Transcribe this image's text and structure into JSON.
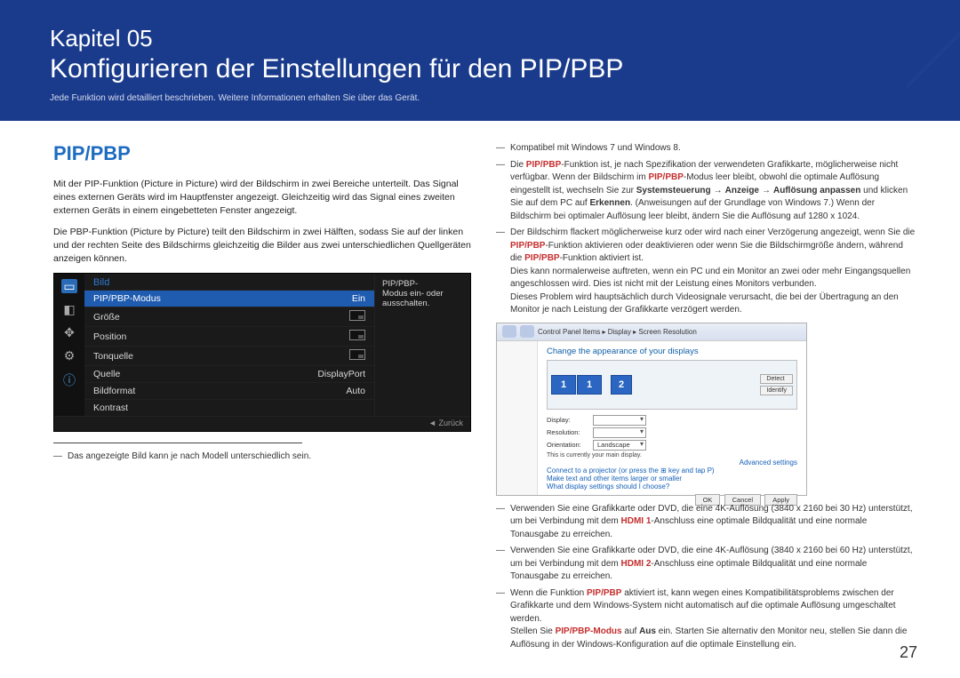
{
  "header": {
    "chapter_label": "Kapitel 05",
    "title": "Konfigurieren der Einstellungen für den PIP/PBP",
    "subtitle": "Jede Funktion wird detailliert beschrieben. Weitere Informationen erhalten Sie über das Gerät."
  },
  "left": {
    "section_title": "PIP/PBP",
    "para1": "Mit der PIP-Funktion (Picture in Picture) wird der Bildschirm in zwei Bereiche unterteilt. Das Signal eines externen Geräts wird im Hauptfenster angezeigt. Gleichzeitig wird das Signal eines zweiten externen Geräts in einem eingebetteten Fenster angezeigt.",
    "para2": "Die PBP-Funktion (Picture by Picture) teilt den Bildschirm in zwei Hälften, sodass Sie auf der linken und der rechten Seite des Bildschirms gleichzeitig die Bilder aus zwei unterschiedlichen Quellgeräten anzeigen können.",
    "footnote": "Das angezeigte Bild kann je nach Modell unterschiedlich sein."
  },
  "osd": {
    "head": "Bild",
    "desc_l1": "PIP/PBP-",
    "desc_l2": "Modus ein- oder",
    "desc_l3": "ausschalten.",
    "foot_symbol": "◄",
    "foot_label": "Zurück",
    "rows": [
      {
        "label": "PIP/PBP-Modus",
        "value": "Ein",
        "selected": true
      },
      {
        "label": "Größe",
        "value": "",
        "thumb": true
      },
      {
        "label": "Position",
        "value": "",
        "thumb": true
      },
      {
        "label": "Tonquelle",
        "value": "",
        "thumb": true
      },
      {
        "label": "Quelle",
        "value": "DisplayPort"
      },
      {
        "label": "Bildformat",
        "value": "Auto"
      },
      {
        "label": "Kontrast",
        "value": ""
      }
    ]
  },
  "right": {
    "note1": "Kompatibel mit Windows 7 und Windows 8.",
    "note2_a": "Die ",
    "note2_b": "PIP/PBP",
    "note2_c": "-Funktion ist, je nach Spezifikation der verwendeten Grafikkarte, möglicherweise nicht verfügbar. Wenn der Bildschirm im ",
    "note2_d": "PIP/PBP",
    "note2_e": "-Modus leer bleibt, obwohl die optimale Auflösung eingestellt ist, wechseln Sie zur ",
    "note2_f": "Systemsteuerung",
    "note2_g": "Anzeige",
    "note2_h": "Auflösung anpassen",
    "note2_i": " und klicken Sie auf dem PC auf ",
    "note2_j": "Erkennen",
    "note2_k": ". (Anweisungen auf der Grundlage von Windows 7.) Wenn der Bildschirm bei optimaler Auflösung leer bleibt, ändern Sie die Auflösung auf 1280 x 1024.",
    "note3_a": "Der Bildschirm flackert möglicherweise kurz oder wird nach einer Verzögerung angezeigt, wenn Sie die ",
    "note3_b": "PIP/PBP",
    "note3_c": "-Funktion aktivieren oder deaktivieren oder wenn Sie die Bildschirmgröße ändern, während die ",
    "note3_d": "PIP/PBP",
    "note3_e": "-Funktion aktiviert ist.",
    "note3_f": "Dies kann normalerweise auftreten, wenn ein PC und ein Monitor an zwei oder mehr Eingangsquellen angeschlossen wird. Dies ist nicht mit der Leistung eines Monitors verbunden.",
    "note3_g": "Dieses Problem wird hauptsächlich durch Videosignale verursacht, die bei der Übertragung an den Monitor je nach Leistung der Grafikkarte verzögert werden.",
    "note4_a": "Verwenden Sie eine Grafikkarte oder DVD, die eine 4K-Auflösung (3840 x 2160 bei 30 Hz) unterstützt, um bei Verbindung mit dem ",
    "note4_b": "HDMI 1",
    "note4_c": "-Anschluss eine optimale Bildqualität und eine normale Tonausgabe zu erreichen.",
    "note5_a": "Verwenden Sie eine Grafikkarte oder DVD, die eine 4K-Auflösung (3840 x 2160 bei 60 Hz) unterstützt, um bei Verbindung mit dem ",
    "note5_b": "HDMI 2",
    "note5_c": "-Anschluss eine optimale Bildqualität und eine normale Tonausgabe zu erreichen.",
    "note6_a": "Wenn die Funktion ",
    "note6_b": "PIP/PBP",
    "note6_c": " aktiviert ist, kann wegen eines Kompatibilitätsproblems zwischen der Grafikkarte und dem Windows-System nicht automatisch auf die optimale Auflösung umgeschaltet werden.",
    "note6_d": "Stellen Sie ",
    "note6_e": "PIP/PBP-Modus",
    "note6_f": " auf ",
    "note6_g": "Aus",
    "note6_h": " ein. Starten Sie alternativ den Monitor neu, stellen Sie dann die Auflösung in der Windows-Konfiguration auf die optimale Einstellung ein."
  },
  "win": {
    "breadcrumb": "Control Panel Items ▸ Display ▸ Screen Resolution",
    "heading": "Change the appearance of your displays",
    "mon1": "1",
    "mon2": "2",
    "btn_detect": "Detect",
    "btn_identify": "Identify",
    "field_display": "Display:",
    "field_resolution": "Resolution:",
    "field_orientation": "Orientation:",
    "val_orientation": "Landscape",
    "note_main": "This is currently your main display.",
    "link_advanced": "Advanced settings",
    "link_projector": "Connect to a projector (or press the ⊞ key and tap P)",
    "link_larger": "Make text and other items larger or smaller",
    "link_what": "What display settings should I choose?",
    "btn_ok": "OK",
    "btn_cancel": "Cancel",
    "btn_apply": "Apply"
  },
  "page_number": "27"
}
